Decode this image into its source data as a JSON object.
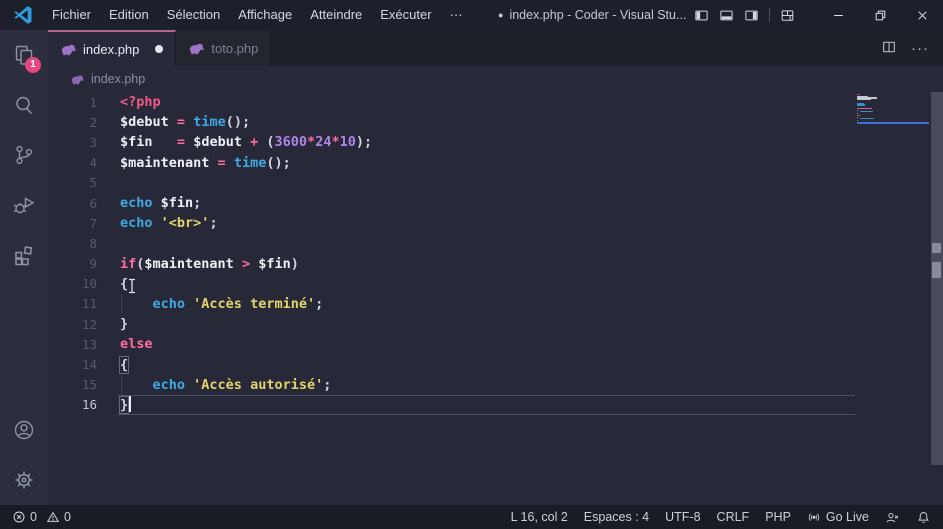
{
  "title_bar": {
    "menus": [
      "Fichier",
      "Edition",
      "Sélection",
      "Affichage",
      "Atteindre",
      "Exécuter"
    ],
    "more_label": "···",
    "modified_dot": "●",
    "window_title": "index.php - Coder - Visual Stu..."
  },
  "activity_bar": {
    "top_items": [
      {
        "name": "explorer",
        "badge": "1"
      },
      {
        "name": "search"
      },
      {
        "name": "source-control"
      },
      {
        "name": "run-debug"
      },
      {
        "name": "extensions"
      }
    ],
    "bottom_items": [
      {
        "name": "account"
      },
      {
        "name": "settings"
      }
    ]
  },
  "tabs": [
    {
      "label": "index.php",
      "active": true,
      "modified": true
    },
    {
      "label": "toto.php",
      "active": false,
      "modified": false
    }
  ],
  "breadcrumb": {
    "file": "index.php"
  },
  "editor": {
    "language": "php",
    "current_line": 16,
    "indent_guide_lines": [
      11,
      15
    ],
    "palette": {
      "tag": "#ef5a87",
      "kw": "#ff6d9e",
      "op": "#ff6d9e",
      "fn": "#3fa9e5",
      "st": "#e4d36b",
      "nu": "#b084e8",
      "v": "#eef0f6",
      "pu": "#d4d7e2",
      "pl": "#eef0f6"
    },
    "lines": [
      {
        "n": 1,
        "tokens": [
          {
            "t": "<?php",
            "c": "tag"
          }
        ]
      },
      {
        "n": 2,
        "tokens": [
          {
            "t": "$debut",
            "c": "v"
          },
          {
            "t": " ",
            "c": "pl"
          },
          {
            "t": "=",
            "c": "op"
          },
          {
            "t": " ",
            "c": "pl"
          },
          {
            "t": "time",
            "c": "fn"
          },
          {
            "t": "();",
            "c": "pu"
          }
        ]
      },
      {
        "n": 3,
        "tokens": [
          {
            "t": "$fin",
            "c": "v"
          },
          {
            "t": "   ",
            "c": "pl"
          },
          {
            "t": "=",
            "c": "op"
          },
          {
            "t": " ",
            "c": "pl"
          },
          {
            "t": "$debut",
            "c": "v"
          },
          {
            "t": " ",
            "c": "pl"
          },
          {
            "t": "+",
            "c": "op"
          },
          {
            "t": " ",
            "c": "pl"
          },
          {
            "t": "(",
            "c": "pu"
          },
          {
            "t": "3600",
            "c": "nu"
          },
          {
            "t": "*",
            "c": "op"
          },
          {
            "t": "24",
            "c": "nu"
          },
          {
            "t": "*",
            "c": "op"
          },
          {
            "t": "10",
            "c": "nu"
          },
          {
            "t": ");",
            "c": "pu"
          }
        ]
      },
      {
        "n": 4,
        "tokens": [
          {
            "t": "$maintenant",
            "c": "v"
          },
          {
            "t": " ",
            "c": "pl"
          },
          {
            "t": "=",
            "c": "op"
          },
          {
            "t": " ",
            "c": "pl"
          },
          {
            "t": "time",
            "c": "fn"
          },
          {
            "t": "();",
            "c": "pu"
          }
        ]
      },
      {
        "n": 5,
        "tokens": []
      },
      {
        "n": 6,
        "tokens": [
          {
            "t": "echo",
            "c": "fn"
          },
          {
            "t": " ",
            "c": "pl"
          },
          {
            "t": "$fin",
            "c": "v"
          },
          {
            "t": ";",
            "c": "pu"
          }
        ]
      },
      {
        "n": 7,
        "tokens": [
          {
            "t": "echo",
            "c": "fn"
          },
          {
            "t": " ",
            "c": "pl"
          },
          {
            "t": "'<br>'",
            "c": "st"
          },
          {
            "t": ";",
            "c": "pu"
          }
        ]
      },
      {
        "n": 8,
        "tokens": []
      },
      {
        "n": 9,
        "tokens": [
          {
            "t": "if",
            "c": "kw"
          },
          {
            "t": "(",
            "c": "pu"
          },
          {
            "t": "$maintenant",
            "c": "v"
          },
          {
            "t": " ",
            "c": "pl"
          },
          {
            "t": ">",
            "c": "op"
          },
          {
            "t": " ",
            "c": "pl"
          },
          {
            "t": "$fin",
            "c": "v"
          },
          {
            "t": ")",
            "c": "pu"
          }
        ]
      },
      {
        "n": 10,
        "tokens": [
          {
            "t": "{",
            "c": "pu"
          }
        ]
      },
      {
        "n": 11,
        "tokens": [
          {
            "t": "    ",
            "c": "pl"
          },
          {
            "t": "echo",
            "c": "fn"
          },
          {
            "t": " ",
            "c": "pl"
          },
          {
            "t": "'Accès terminé'",
            "c": "st"
          },
          {
            "t": ";",
            "c": "pu"
          }
        ]
      },
      {
        "n": 12,
        "tokens": [
          {
            "t": "}",
            "c": "pu"
          }
        ]
      },
      {
        "n": 13,
        "tokens": [
          {
            "t": "else",
            "c": "kw"
          }
        ]
      },
      {
        "n": 14,
        "tokens": [
          {
            "t": "{",
            "c": "pu",
            "m": true
          }
        ]
      },
      {
        "n": 15,
        "tokens": [
          {
            "t": "    ",
            "c": "pl"
          },
          {
            "t": "echo",
            "c": "fn"
          },
          {
            "t": " ",
            "c": "pl"
          },
          {
            "t": "'Accès autorisé'",
            "c": "st"
          },
          {
            "t": ";",
            "c": "pu"
          }
        ]
      },
      {
        "n": 16,
        "tokens": [
          {
            "t": "}",
            "c": "pu",
            "m": true
          }
        ],
        "caret": true
      }
    ]
  },
  "status_bar": {
    "errors": "0",
    "warnings": "0",
    "items": [
      {
        "label": "L 16, col 2"
      },
      {
        "label": "Espaces : 4"
      },
      {
        "label": "UTF-8"
      },
      {
        "label": "CRLF"
      },
      {
        "label": "PHP"
      },
      {
        "label": "Go Live",
        "icon": "broadcast"
      }
    ],
    "icon_buttons": [
      {
        "name": "feedback"
      },
      {
        "name": "bell"
      }
    ]
  },
  "colors": {
    "accent_tab_border": "#b06a92",
    "badge": "#e8467f",
    "editor_bg": "#272938",
    "titlebar_bg": "#1d1f2a",
    "statusbar_bg": "#191b25",
    "minimap_current_line": "#3f6fd8"
  }
}
